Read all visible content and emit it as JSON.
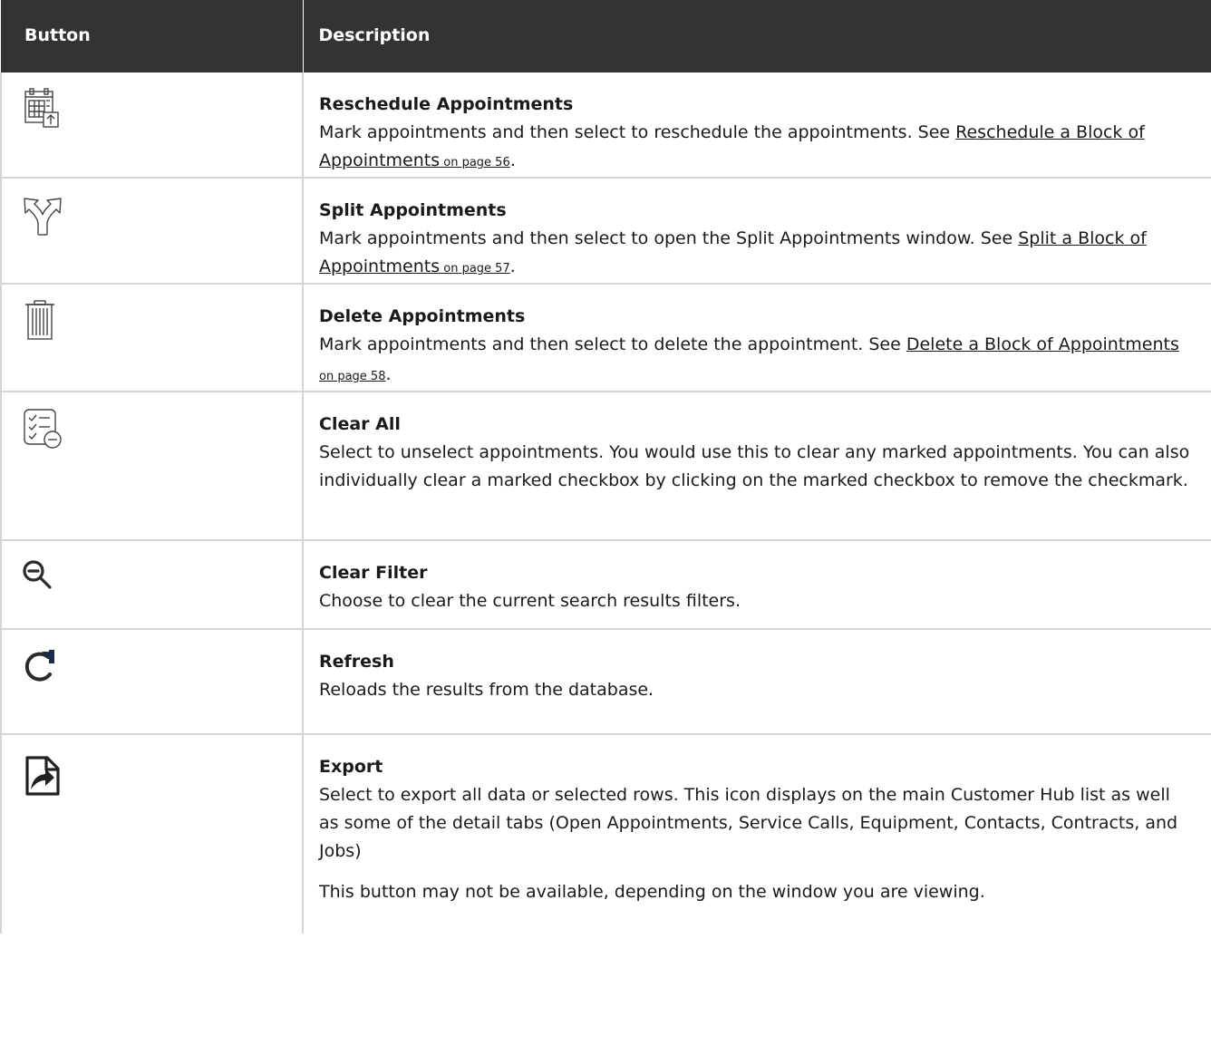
{
  "header": {
    "col1": "Button",
    "col2": "Description"
  },
  "rows": [
    {
      "icon": "calendar-reschedule-icon",
      "title": "Reschedule Appointments",
      "text": "Mark appointments and then select to reschedule the appointments. See ",
      "link": "Reschedule a Block of Appointments",
      "page": " on page 56",
      "end": "."
    },
    {
      "icon": "split-arrows-icon",
      "title": "Split Appointments",
      "text": "Mark appointments and then select to open the Split Appointments window. See ",
      "link": "Split a Block of Appointments",
      "page": " on page 57",
      "end": "."
    },
    {
      "icon": "trash-icon",
      "title": "Delete Appointments",
      "text": "Mark appointments and then select to delete the appointment. See ",
      "link": "Delete a Block of Appointments",
      "page": " on page 58",
      "end": "."
    },
    {
      "icon": "checklist-clear-icon",
      "title": "Clear All",
      "text": "Select to unselect appointments. You would use this to clear any marked appointments. You can also individually clear a marked checkbox by clicking on the marked checkbox to remove the checkmark."
    },
    {
      "icon": "zoom-out-icon",
      "title": "Clear Filter",
      "text": "Choose to clear the current search results filters."
    },
    {
      "icon": "refresh-icon",
      "title": "Refresh",
      "text": "Reloads the results from the database."
    },
    {
      "icon": "export-icon",
      "title": "Export",
      "text": "Select to export all data or selected rows. This icon displays on the main Customer Hub list as well as some of the detail tabs (Open Appointments, Service Calls, Equipment, Contacts, Contracts, and Jobs)",
      "note": "This button may not be available, depending on the window you are viewing."
    }
  ]
}
